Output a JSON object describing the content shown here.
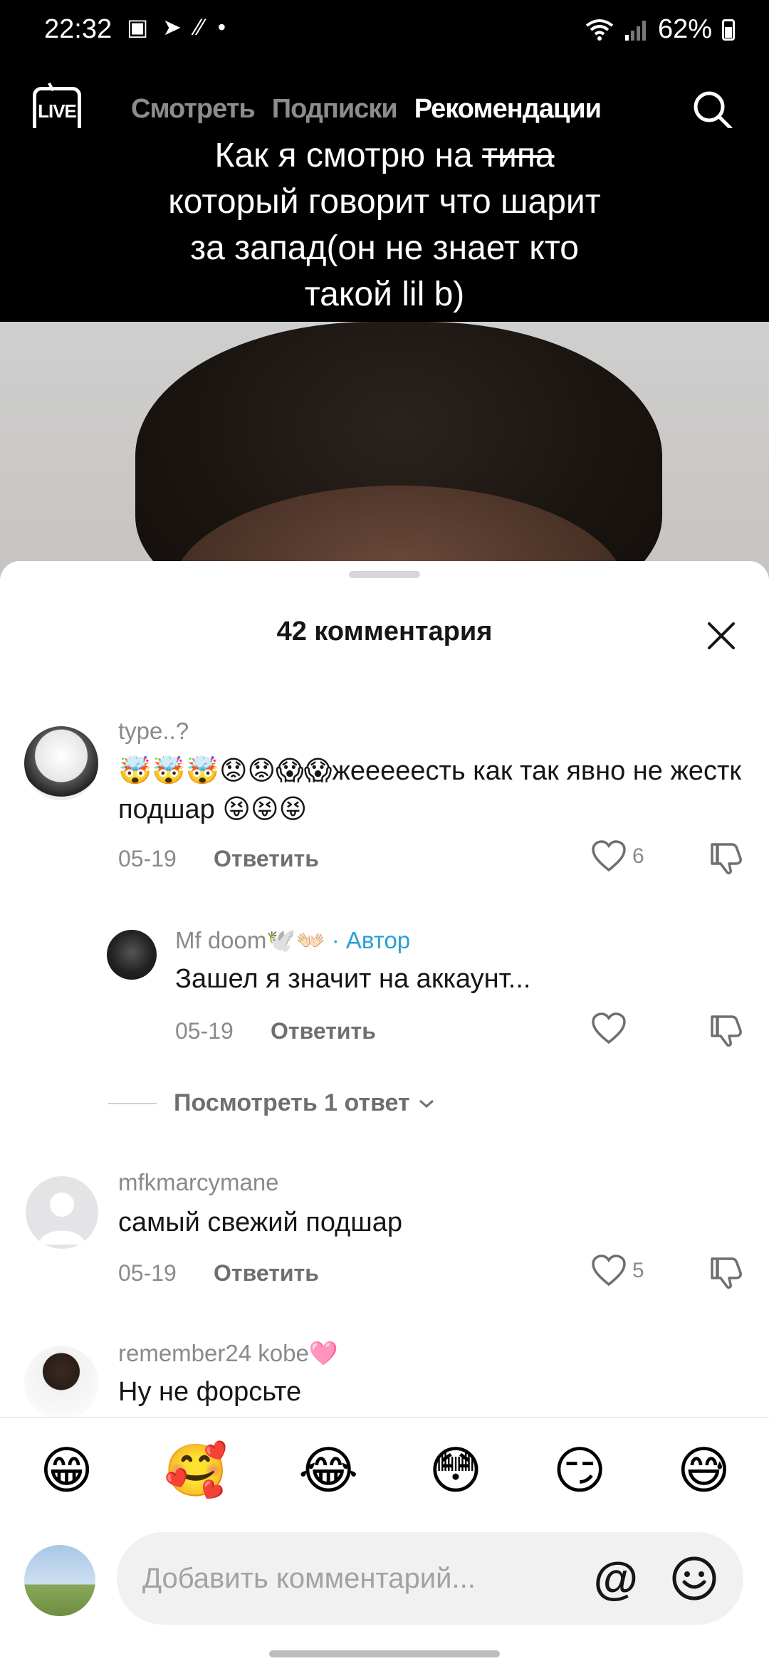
{
  "status_bar": {
    "time": "22:32",
    "battery": "62%",
    "left_icons": [
      "gallery-icon",
      "telegram-icon",
      "network-activity-icon",
      "dot"
    ],
    "right_icons": [
      "wifi-icon",
      "roaming-signal-icon",
      "battery-icon"
    ]
  },
  "nav": {
    "live_label": "LIVE",
    "tabs": [
      {
        "label": "Смотреть",
        "active": false
      },
      {
        "label": "Подписки",
        "active": false
      },
      {
        "label": "Рекомендации",
        "active": true
      }
    ]
  },
  "video": {
    "caption_part1": "Как я смотрю на ",
    "caption_strike": "типа",
    "caption_part2": " который говорит что шарит за запад(он не знает кто такой lil b)"
  },
  "comments_sheet": {
    "title": "42 комментария",
    "comments": [
      {
        "user": "type..?",
        "text": "🤯🤯🤯😟😟😱😱жееееесть как так явно не жестк подшар 😝😝😝",
        "date": "05-19",
        "reply_label": "Ответить",
        "likes": "6"
      },
      {
        "user": "Mf doom🕊️👐🏻",
        "author_tag": " · Автор",
        "text": "Зашел я значит на аккаунт...",
        "date": "05-19",
        "reply_label": "Ответить",
        "likes": ""
      },
      {
        "user": "mfkmarcymane",
        "text": "самый свежий подшар",
        "date": "05-19",
        "reply_label": "Ответить",
        "likes": "5"
      },
      {
        "user": "remember24 kobe🩷",
        "text": "Ну не форсьте"
      }
    ],
    "more_replies": "Посмотреть 1 ответ"
  },
  "composer": {
    "quick_emojis": [
      "😁",
      "🥰",
      "😂",
      "😳",
      "😏",
      "😅"
    ],
    "placeholder": "Добавить комментарий...",
    "at_label": "@"
  },
  "colors": {
    "author_tag": "#2a9fd8",
    "meta_gray": "#8a8a8a",
    "text_dark": "#161616"
  }
}
